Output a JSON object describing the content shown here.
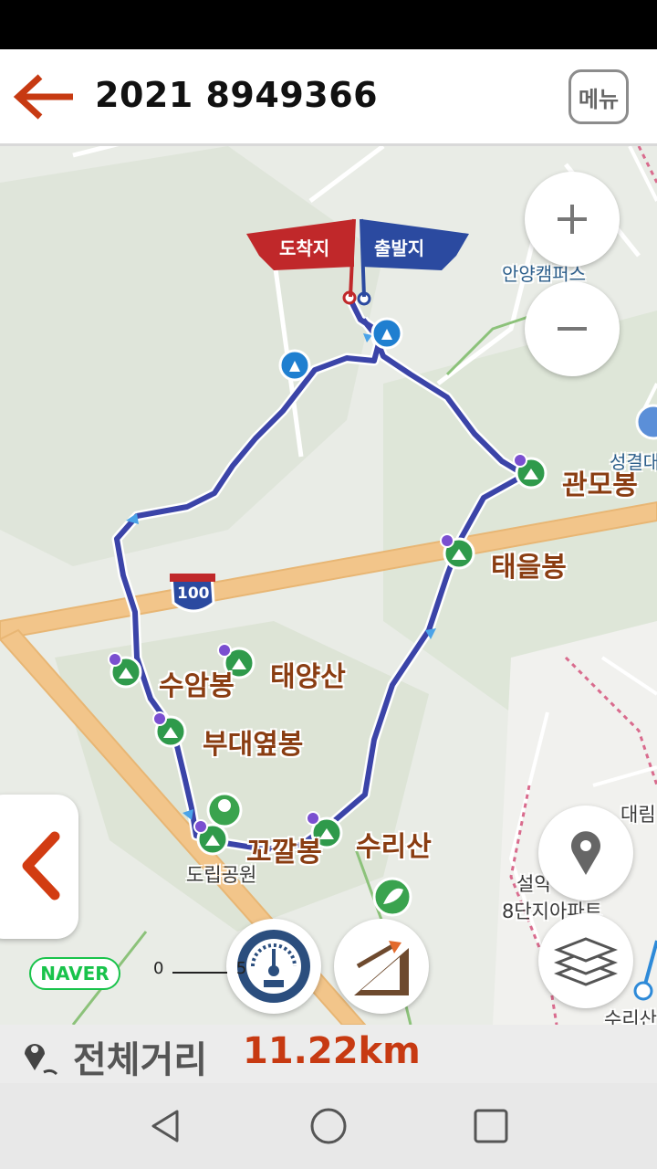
{
  "header": {
    "title": "2021 8949366",
    "menu_label": "메뉴"
  },
  "map": {
    "flags": {
      "end": "도착지",
      "start": "출발지"
    },
    "peaks": [
      "관모봉",
      "태을봉",
      "수암봉",
      "태양산",
      "부대옆봉",
      "꼬깔봉",
      "수리산"
    ],
    "places": [
      "도립공원",
      "안양캠퍼스",
      "성결대",
      "대림",
      "설악",
      "8단지아파트",
      "수리산"
    ],
    "route_shield": "100",
    "naver_logo": "NAVER",
    "scale_ticks": [
      "0",
      "5"
    ],
    "colors": {
      "route": "#3b44a8",
      "highway": "#f2c58a",
      "peak_text": "#8a3d12",
      "accent": "#c73a12"
    }
  },
  "footer": {
    "distance_label": "전체거리",
    "distance_value": "11.22km"
  },
  "icons": [
    "back-arrow-icon",
    "zoom-in-icon",
    "zoom-out-icon",
    "location-pin-icon",
    "layers-icon",
    "speedometer-icon",
    "elevation-icon",
    "collapse-left-icon"
  ]
}
